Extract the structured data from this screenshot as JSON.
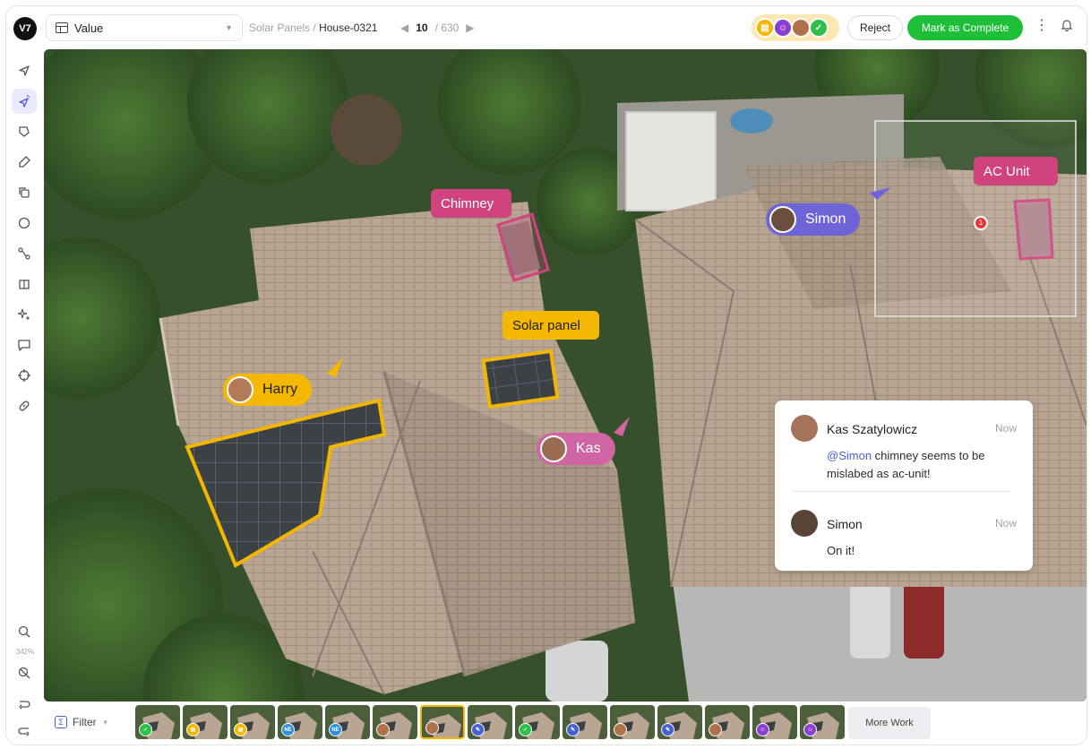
{
  "header": {
    "logo": "V7",
    "view_select": {
      "value": "Value",
      "icon": "grid-icon"
    },
    "breadcrumb": {
      "dataset": "Solar Panels /",
      "item": "House-0321"
    },
    "pager": {
      "current": "10",
      "total": "/ 630"
    },
    "reject_label": "Reject",
    "complete_label": "Mark as Complete"
  },
  "colors": {
    "accent_green": "#1fbf3a",
    "label_pink": "#d0437f",
    "label_yellow": "#f5b800",
    "user_purple": "#6f63d8",
    "user_pink": "#d065a4",
    "mention_blue": "#4762d3"
  },
  "toolbar": {
    "tools": [
      "navigate-icon",
      "auto-annotate-icon",
      "polygon-icon",
      "brush-icon",
      "clone-icon",
      "ellipse-icon",
      "keypoint-icon",
      "cuboid-icon",
      "magic-icon",
      "comment-icon",
      "crosshair-icon",
      "link-icon"
    ],
    "bottom_tools": [
      "zoom-icon",
      "reset-zoom-icon",
      "undo-icon",
      "redo-icon"
    ],
    "zoom_level": "342%"
  },
  "canvas": {
    "labels": {
      "chimney": "Chimney",
      "ac_unit": "AC Unit",
      "solar_panel": "Solar panel"
    },
    "users": {
      "harry": "Harry",
      "kas": "Kas",
      "simon": "Simon"
    },
    "comment_count": "1",
    "comments": [
      {
        "author": "Kas Szatylowicz",
        "time": "Now",
        "mention": "@Simon",
        "text": " chimney seems to be mislabed as ac-unit!"
      },
      {
        "author": "Simon",
        "time": "Now",
        "text": "On it!"
      }
    ]
  },
  "bottom": {
    "filter_label": "Filter",
    "more_work_label": "More Work",
    "thumb_badges": [
      "check",
      "doc",
      "doc",
      "NE",
      "NE",
      "avatar",
      "avatar",
      "pen",
      "check",
      "pen",
      "avatar",
      "pen",
      "avatar",
      "review",
      "review"
    ],
    "thumb_badge_text": {
      "NE": "NE"
    }
  }
}
